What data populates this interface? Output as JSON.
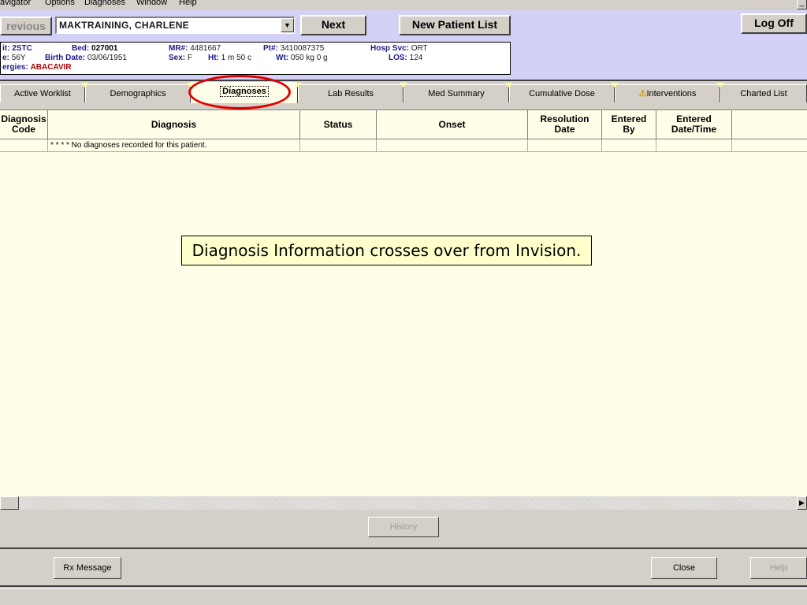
{
  "menu": [
    "avigator",
    "Options",
    "Diagnoses",
    "Window",
    "Help"
  ],
  "window_controls": {
    "minimize": "_"
  },
  "nav": {
    "previous": "revious",
    "patient_name": "MAKTRAINING, CHARLENE",
    "next": "Next",
    "new_patient_list": "New Patient List",
    "log_off": "Log Off"
  },
  "patient": {
    "unit_label": "it:",
    "unit": "2STC",
    "bed_label": "Bed:",
    "bed": "027001",
    "mr_label": "MR#:",
    "mr": "4481667",
    "pt_label": "Pt#:",
    "pt": "3410087375",
    "hosp_svc_label": "Hosp Svc:",
    "hosp_svc": "ORT",
    "age_label": "e:",
    "age": "56Y",
    "birth_date_label": "Birth Date:",
    "birth_date": "03/06/1951",
    "sex_label": "Sex:",
    "sex": "F",
    "ht_label": "Ht:",
    "ht": "1 m 50 c",
    "wt_label": "Wt:",
    "wt": "050 kg 0 g",
    "los_label": "LOS:",
    "los": "124",
    "allergies_label": "ergies:",
    "allergies": "ABACAVIR"
  },
  "tabs": [
    {
      "label": "Active Worklist"
    },
    {
      "label": "Demographics"
    },
    {
      "label": "Diagnoses",
      "active": true
    },
    {
      "label": "Lab Results"
    },
    {
      "label": "Med Summary"
    },
    {
      "label": "Cumulative Dose"
    },
    {
      "label": "Interventions",
      "icon": "warning-icon"
    },
    {
      "label": "Charted List"
    }
  ],
  "grid": {
    "columns": [
      "Diagnosis\nCode",
      "Diagnosis",
      "Status",
      "Onset",
      "Resolution\nDate",
      "Entered\nBy",
      "Entered\nDate/Time",
      ""
    ],
    "rows": [
      [
        "",
        "* * * * No diagnoses recorded for this patient.",
        "",
        "",
        "",
        "",
        "",
        ""
      ]
    ]
  },
  "callout": "Diagnosis Information crosses over from Invision.",
  "buttons": {
    "history": "History",
    "rx_message": "Rx Message",
    "close": "Close",
    "help": "Help"
  },
  "colors": {
    "header_band": "#d3d2f6",
    "grid_background": "#fffee8",
    "allergy": "#b00000",
    "highlight": "#e00000"
  }
}
